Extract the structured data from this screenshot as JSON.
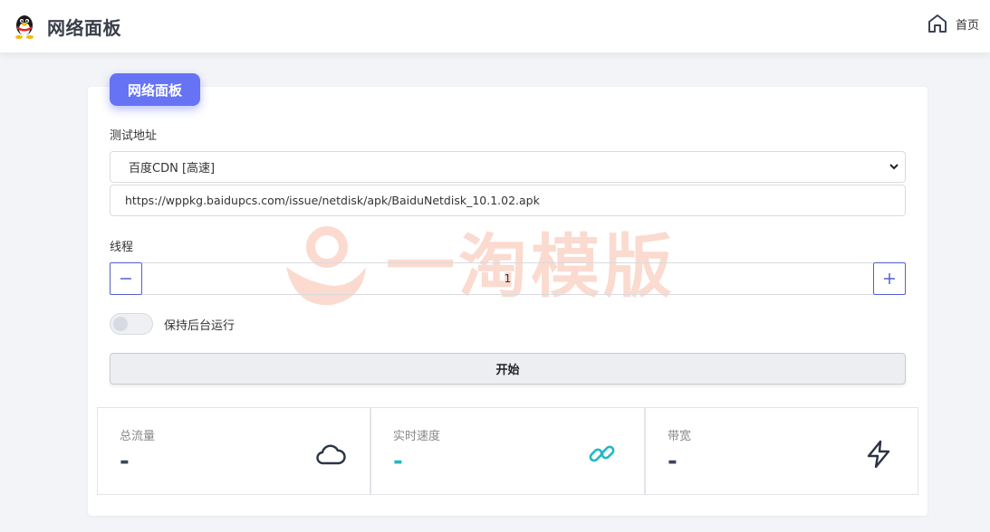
{
  "header": {
    "title": "网络面板",
    "home_label": "首页"
  },
  "panel": {
    "badge": "网络面板",
    "test_address_label": "测试地址",
    "selected_source": "百度CDN [高速]",
    "url_value": "https://wppkg.baidupcs.com/issue/netdisk/apk/BaiduNetdisk_10.1.02.apk",
    "threads_label": "线程",
    "threads_value": "1",
    "keep_background_label": "保持后台运行",
    "keep_background_on": false,
    "start_label": "开始"
  },
  "stats": [
    {
      "label": "总流量",
      "value": "-",
      "icon": "cloud-icon",
      "color": "#3a4458"
    },
    {
      "label": "实时速度",
      "value": "-",
      "icon": "link-icon",
      "color": "#22b8c4"
    },
    {
      "label": "带宽",
      "value": "-",
      "icon": "lightning-icon",
      "color": "#3a4458"
    }
  ],
  "watermark": "一淘模版",
  "colors": {
    "accent": "#6673f4",
    "stepper_border": "#5360c9",
    "cyan": "#22b8c4",
    "watermark": "#f15a2b"
  }
}
